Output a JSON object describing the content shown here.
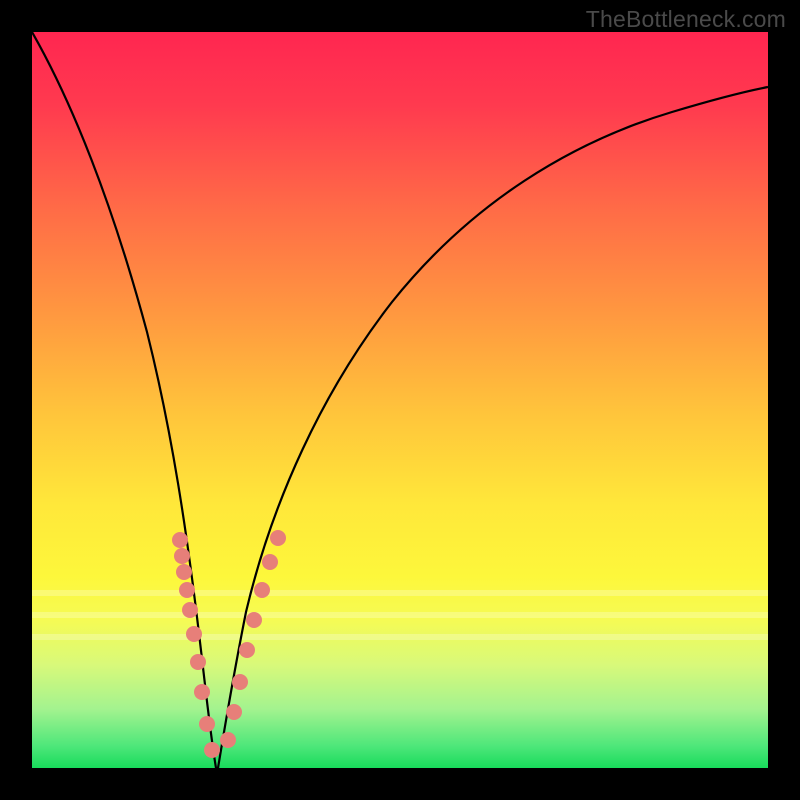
{
  "watermark": "TheBottleneck.com",
  "chart_data": {
    "type": "line",
    "title": "",
    "xlabel": "",
    "ylabel": "",
    "xlim": [
      0,
      100
    ],
    "ylim": [
      0,
      100
    ],
    "grid": false,
    "legend": false,
    "series": [
      {
        "name": "bottleneck-curve",
        "x": [
          0,
          3,
          6,
          9,
          12,
          14,
          16,
          18,
          20,
          21.5,
          22.5,
          23.5,
          24.5,
          25.5,
          27,
          29,
          32,
          36,
          40,
          45,
          50,
          56,
          62,
          68,
          74,
          80,
          86,
          92,
          100
        ],
        "y": [
          100,
          94,
          86,
          78,
          69,
          61,
          52,
          42,
          30,
          18,
          9,
          3,
          0,
          3,
          9,
          16,
          24,
          33,
          41,
          49,
          56,
          62,
          67,
          72,
          76,
          79.5,
          82.5,
          85,
          88
        ]
      }
    ],
    "annotations": {
      "highlight_bands_y": [
        74,
        78,
        82
      ],
      "marked_points_x": [
        18.2,
        18.8,
        19.4,
        20.0,
        20.8,
        21.4,
        22.2,
        22.8,
        23.6,
        27.0,
        27.8,
        28.6,
        29.4,
        30.2,
        31.0,
        31.8
      ]
    },
    "background_gradient": {
      "top": "#ff2650",
      "middle": "#ffe73a",
      "bottom": "#18db5b"
    }
  }
}
